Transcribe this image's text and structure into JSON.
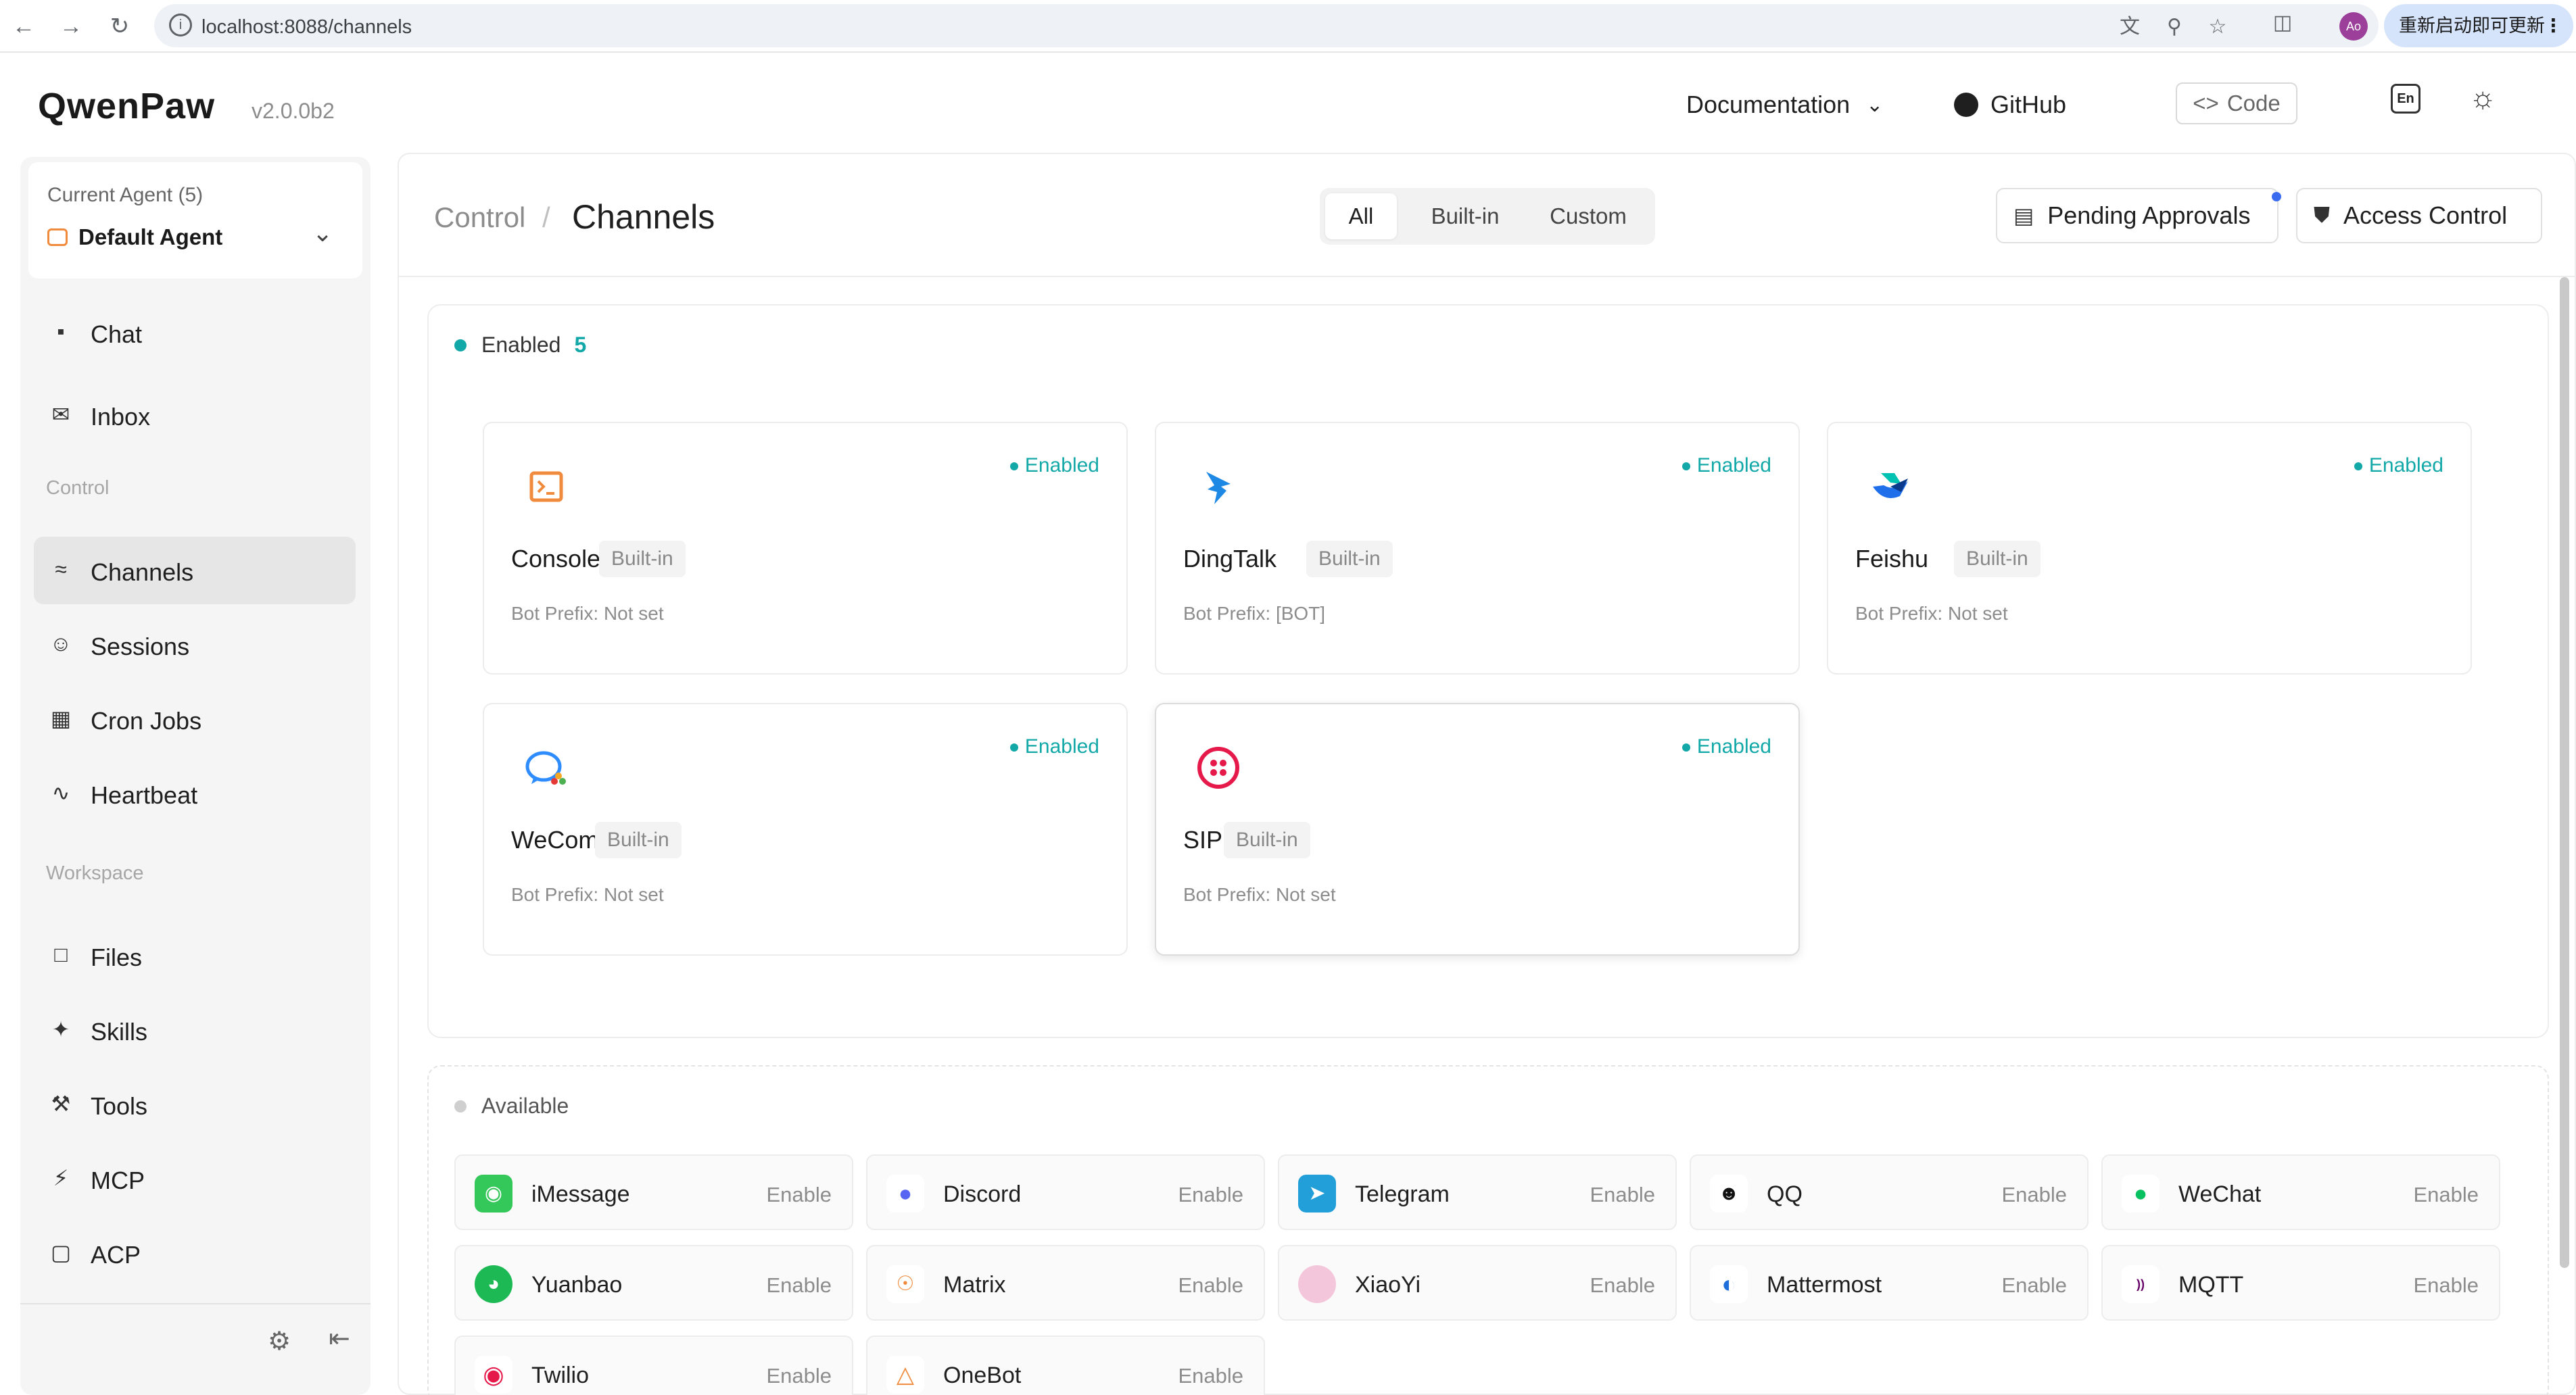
{
  "browser": {
    "url": "localhost:8088/channels",
    "update_label": "重新启动即可更新",
    "profile_initials": "Ao"
  },
  "header": {
    "logo": "QwenPaw",
    "version": "v2.0.0b2",
    "documentation": "Documentation",
    "github": "GitHub",
    "code": "Code",
    "lang": "En"
  },
  "sidebar": {
    "agent_title": "Current Agent (5)",
    "agent_name": "Default Agent",
    "items": [
      {
        "label": "Chat",
        "icon": "chat-icon"
      },
      {
        "label": "Inbox",
        "icon": "mail-icon"
      }
    ],
    "section_control": "Control",
    "control_items": [
      {
        "label": "Channels",
        "icon": "wifi-icon",
        "active": true
      },
      {
        "label": "Sessions",
        "icon": "users-icon"
      },
      {
        "label": "Cron Jobs",
        "icon": "calendar-icon"
      },
      {
        "label": "Heartbeat",
        "icon": "pulse-icon"
      }
    ],
    "section_workspace": "Workspace",
    "workspace_items": [
      {
        "label": "Files",
        "icon": "folder-icon"
      },
      {
        "label": "Skills",
        "icon": "magic-icon"
      },
      {
        "label": "Tools",
        "icon": "wrench-icon"
      },
      {
        "label": "MCP",
        "icon": "bolt-icon"
      },
      {
        "label": "ACP",
        "icon": "scan-icon"
      }
    ]
  },
  "page": {
    "breadcrumb_parent": "Control",
    "breadcrumb_sep": "/",
    "title": "Channels",
    "filters": [
      "All",
      "Built-in",
      "Custom"
    ],
    "active_filter": "All",
    "pending_approvals": "Pending Approvals",
    "access_control": "Access Control"
  },
  "enabled": {
    "label": "Enabled",
    "count": "5",
    "status_text": "Enabled",
    "cards": [
      {
        "name": "Console",
        "tag": "Built-in",
        "prefix": "Bot Prefix: Not set",
        "icon": "console-icon",
        "color": "#f08a3c"
      },
      {
        "name": "DingTalk",
        "tag": "Built-in",
        "prefix": "Bot Prefix: [BOT]",
        "icon": "dingtalk-icon",
        "color": "#1e88e5"
      },
      {
        "name": "Feishu",
        "tag": "Built-in",
        "prefix": "Bot Prefix: Not set",
        "icon": "feishu-icon",
        "color": "#1f6feb"
      },
      {
        "name": "WeCom",
        "tag": "Built-in",
        "prefix": "Bot Prefix: Not set",
        "icon": "wecom-icon",
        "color": "#2f8cff"
      },
      {
        "name": "SIP",
        "tag": "Built-in",
        "prefix": "Bot Prefix: Not set",
        "icon": "sip-icon",
        "color": "#e6194b"
      }
    ]
  },
  "available": {
    "label": "Available",
    "enable_label": "Enable",
    "items": [
      {
        "name": "iMessage",
        "icon": "imessage-icon",
        "color": "#34c759"
      },
      {
        "name": "Discord",
        "icon": "discord-icon",
        "color": "#5865f2"
      },
      {
        "name": "Telegram",
        "icon": "telegram-icon",
        "color": "#229ed9"
      },
      {
        "name": "QQ",
        "icon": "qq-icon",
        "color": "#111111"
      },
      {
        "name": "WeChat",
        "icon": "wechat-icon",
        "color": "#07c160"
      },
      {
        "name": "Yuanbao",
        "icon": "yuanbao-icon",
        "color": "#1db954"
      },
      {
        "name": "Matrix",
        "icon": "matrix-icon",
        "color": "#f08a3c"
      },
      {
        "name": "XiaoYi",
        "icon": "xiaoyi-icon",
        "color": "#e88fb5"
      },
      {
        "name": "Mattermost",
        "icon": "mattermost-icon",
        "color": "#1e6fd9"
      },
      {
        "name": "MQTT",
        "icon": "mqtt-icon",
        "color": "#660066"
      },
      {
        "name": "Twilio",
        "icon": "twilio-icon",
        "color": "#e6194b"
      },
      {
        "name": "OneBot",
        "icon": "onebot-icon",
        "color": "#f08a3c"
      }
    ]
  }
}
